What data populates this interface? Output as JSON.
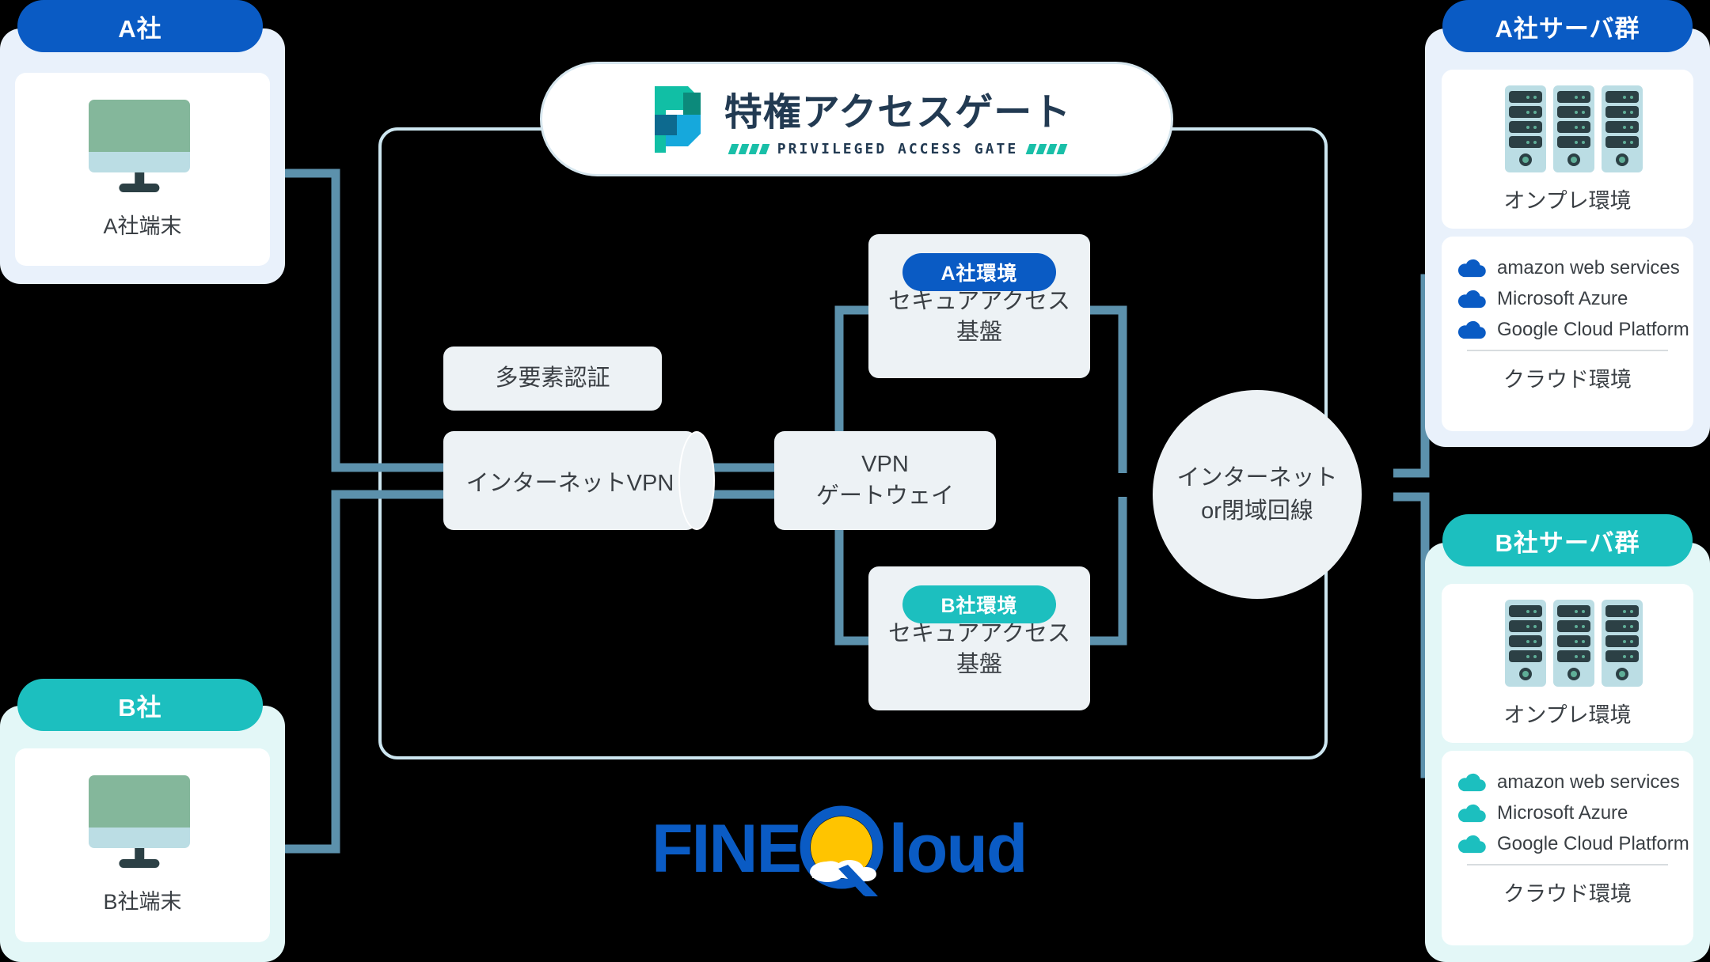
{
  "colors": {
    "brand_blue": "#0A5BC4",
    "brand_teal": "#1CBFBF",
    "connector": "#5C91AC",
    "gate_border": "#D6E6EE",
    "box_fill": "#EDF2F5",
    "panel_a_fill": "#E9F1FB",
    "panel_b_fill": "#E3F7F7",
    "logo_teal": "#11BFA5",
    "logo_teal_dark": "#0C8A7B",
    "logo_blue": "#16A8DC",
    "logo_blue_dark": "#0D6A8F",
    "sun_yellow": "#FFC400"
  },
  "gate": {
    "title": "特権アクセスゲート",
    "subtitle": "PRIVILEGED ACCESS GATE",
    "logo_mark": "p-block-logo"
  },
  "clients": [
    {
      "badge": "A社",
      "device_label": "A社端末",
      "theme": "a",
      "icon": "desktop-monitor-icon"
    },
    {
      "badge": "B社",
      "device_label": "B社端末",
      "theme": "b",
      "icon": "desktop-monitor-icon"
    }
  ],
  "center": {
    "mfa": "多要素認証",
    "internet_vpn": "インターネットVPN",
    "vpn_gateway_line1": "VPN",
    "vpn_gateway_line2": "ゲートウェイ",
    "internet_line1": "インターネット",
    "internet_line2": "or閉域回線"
  },
  "environments": [
    {
      "badge": "A社環境",
      "theme": "a",
      "line1": "セキュアアクセス",
      "line2": "基盤"
    },
    {
      "badge": "B社環境",
      "theme": "b",
      "line1": "セキュアアクセス",
      "line2": "基盤"
    }
  ],
  "server_groups": [
    {
      "badge": "A社サーバ群",
      "theme": "a",
      "onprem_label": "オンプレ環境",
      "cloud_label": "クラウド環境",
      "rack_icon": "server-rack-icon",
      "clouds": [
        {
          "name": "amazon web services",
          "icon": "cloud-icon"
        },
        {
          "name": "Microsoft Azure",
          "icon": "cloud-icon"
        },
        {
          "name": "Google Cloud Platform",
          "icon": "cloud-icon"
        }
      ]
    },
    {
      "badge": "B社サーバ群",
      "theme": "b",
      "onprem_label": "オンプレ環境",
      "cloud_label": "クラウド環境",
      "rack_icon": "server-rack-icon",
      "clouds": [
        {
          "name": "amazon web services",
          "icon": "cloud-icon"
        },
        {
          "name": "Microsoft Azure",
          "icon": "cloud-icon"
        },
        {
          "name": "Google Cloud Platform",
          "icon": "cloud-icon"
        }
      ]
    }
  ],
  "footer_logo": {
    "text_left": "FINE",
    "text_right": "loud",
    "mark": "sun-cloud-q-icon"
  }
}
